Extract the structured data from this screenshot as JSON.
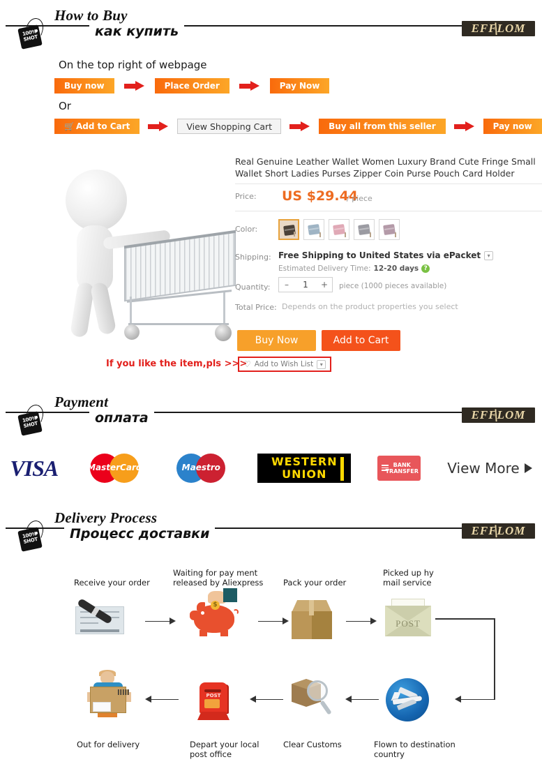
{
  "brand": {
    "name": "EFFLOM"
  },
  "tag": {
    "line1": "100%",
    "line2": "SHOT"
  },
  "sections": {
    "how_to_buy": {
      "title_en": "How to Buy",
      "title_ru": "как купить"
    },
    "payment": {
      "title_en": "Payment",
      "title_ru": "оплата"
    },
    "delivery": {
      "title_en": "Delivery Process",
      "title_ru": "Процесс доставки"
    }
  },
  "how_to_buy": {
    "intro": "On the top right of webpage",
    "or": "Or",
    "row1": [
      "Buy now",
      "Place Order",
      "Pay Now"
    ],
    "row2_cart": "Add to Cart",
    "row2": [
      "View Shopping Cart",
      "Buy all from this seller",
      "Pay now"
    ]
  },
  "product": {
    "title": "Real Genuine Leather Wallet Women Luxury Brand Cute Fringe Small Wallet Short Ladies Purses Zipper Coin Purse Pouch Card Holder",
    "price_label": "Price:",
    "price": "US $29.44",
    "price_unit": "/ piece",
    "color_label": "Color:",
    "colors": [
      {
        "name": "dark-brown",
        "hex": "#4a4038",
        "selected": true
      },
      {
        "name": "blue-grey",
        "hex": "#9fb4c4",
        "selected": false
      },
      {
        "name": "pink",
        "hex": "#e0a9b6",
        "selected": false
      },
      {
        "name": "grey",
        "hex": "#9b9ba2",
        "selected": false
      },
      {
        "name": "mauve",
        "hex": "#b49aa8",
        "selected": false
      }
    ],
    "shipping_label": "Shipping:",
    "shipping_value": "Free Shipping to United States via ePacket",
    "delivery_est_prefix": "Estimated Delivery Time:",
    "delivery_est_value": "12-20 days",
    "quantity_label": "Quantity:",
    "quantity_value": "1",
    "quantity_minus": "–",
    "quantity_plus": "+",
    "quantity_note": "piece (1000 pieces available)",
    "total_label": "Total Price:",
    "total_note": "Depends on the product properties you select",
    "buy_now": "Buy Now",
    "add_to_cart": "Add to Cart",
    "wish_prompt": "If you like the item,pls >>>",
    "wish_label": "Add to Wish List"
  },
  "payment_methods": [
    {
      "name": "visa",
      "label": "VISA"
    },
    {
      "name": "mastercard",
      "label": "MasterCard",
      "part1": "Master",
      "part2": "Card"
    },
    {
      "name": "maestro",
      "label": "Maestro"
    },
    {
      "name": "western-union",
      "label": "WESTERN UNION",
      "line1": "WESTERN",
      "line2": "UNION"
    },
    {
      "name": "bank-transfer",
      "label": "BANK TRANSFER",
      "line1": "BANK",
      "line2": "TRANSFER"
    },
    {
      "name": "view-more",
      "label": "View More"
    }
  ],
  "delivery_steps": [
    {
      "id": "receive-order",
      "label": "Receive your order",
      "icon": "cheque-pen-icon"
    },
    {
      "id": "waiting-payment",
      "label": "Waiting for pay ment released by Aliexpress",
      "icon": "piggy-bank-icon"
    },
    {
      "id": "pack-order",
      "label": "Pack your order",
      "icon": "carton-box-icon"
    },
    {
      "id": "picked-up",
      "label": "Picked up hy mail service",
      "icon": "post-envelope-icon",
      "envelope_text": "POST"
    },
    {
      "id": "flown",
      "label": "Flown to destination country",
      "icon": "airplane-icon"
    },
    {
      "id": "clear-customs",
      "label": "Clear Customs",
      "icon": "box-magnifier-icon"
    },
    {
      "id": "depart-post",
      "label": "Depart your local post office",
      "icon": "post-box-icon",
      "box_text": "POST"
    },
    {
      "id": "out-for-delivery",
      "label": "Out for delivery",
      "icon": "delivery-man-icon"
    }
  ]
}
